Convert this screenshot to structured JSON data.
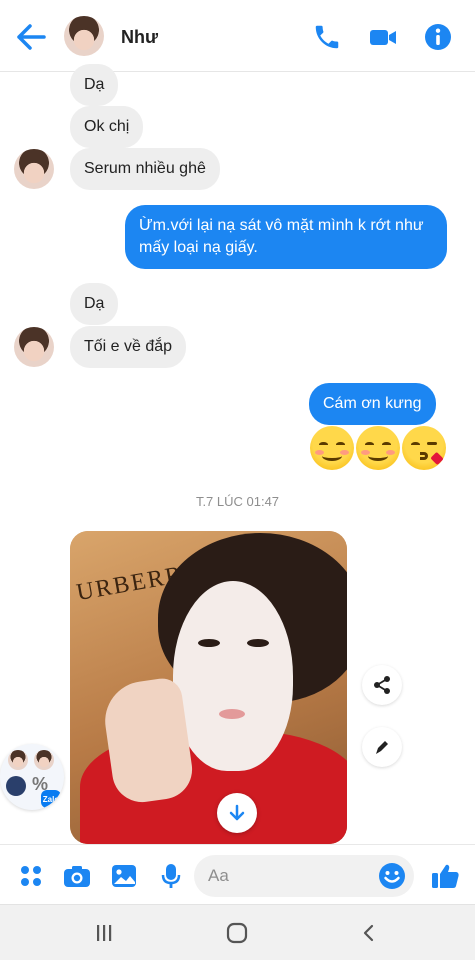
{
  "header": {
    "contact_name": "Như",
    "icons": [
      "back-arrow-icon",
      "phone-icon",
      "video-call-icon",
      "info-icon"
    ],
    "accent_color": "#1c86f2"
  },
  "messages": [
    {
      "side": "in",
      "text": "Dạ"
    },
    {
      "side": "in",
      "text": "Ok chị"
    },
    {
      "side": "in",
      "text": "Serum nhiều ghê"
    },
    {
      "side": "out",
      "text": "Ừm.với lại nạ sát vô mặt mình k rớt như mấy loại nạ giấy."
    },
    {
      "side": "in",
      "text": "Dạ"
    },
    {
      "side": "in",
      "text": "Tối e về đắp"
    },
    {
      "side": "out",
      "text": "Cám ơn kưng"
    }
  ],
  "emojis": [
    "smiling-emoji",
    "smiling-emoji",
    "kissing-emoji"
  ],
  "timestamp": "T.7 LÚC 01:47",
  "photo": {
    "print_text": "URBERR",
    "actions": [
      "share-icon",
      "edit-icon",
      "download-icon"
    ]
  },
  "chat_head": {
    "badge": "Zalo",
    "percent": "%"
  },
  "composer": {
    "placeholder": "Aa",
    "icons": [
      "menu-grid-icon",
      "camera-icon",
      "gallery-icon",
      "microphone-icon",
      "emoji-icon",
      "like-icon"
    ]
  },
  "nav": {
    "icons": [
      "recent-apps-icon",
      "home-icon",
      "back-icon"
    ]
  }
}
